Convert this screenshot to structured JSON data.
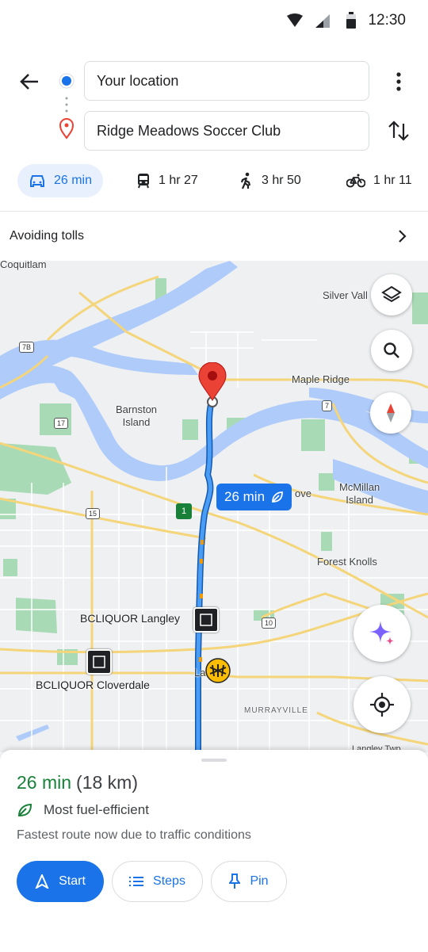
{
  "status_bar": {
    "time": "12:30"
  },
  "directions": {
    "origin": "Your location",
    "destination": "Ridge Meadows Soccer Club"
  },
  "modes": [
    {
      "icon": "car-icon",
      "label": "26 min",
      "selected": true
    },
    {
      "icon": "transit-icon",
      "label": "1 hr 27"
    },
    {
      "icon": "walk-icon",
      "label": "3 hr 50"
    },
    {
      "icon": "bike-icon",
      "label": "1 hr 11"
    }
  ],
  "route_option": "Avoiding tolls",
  "map": {
    "places": {
      "coquitlam": "Coquitlam",
      "silver_valley": "Silver Vall",
      "maple_ridge": "Maple Ridge",
      "barnston_island": "Barnston\nIsland",
      "mcmillan_island": "McMillan\nIsland",
      "forest_knolls": "Forest Knolls",
      "murrayville": "MURRAYVILLE",
      "langley_twp": "Langley Twp",
      "langley_partial": "La",
      "ove_partial": "ove"
    },
    "pois": {
      "bcl_langley": "BCLIQUOR Langley",
      "bcl_cloverdale": "BCLIQUOR Cloverdale"
    },
    "shields": {
      "s7b": "7B",
      "s17": "17",
      "s7": "7",
      "s15": "15",
      "s10": "10",
      "s1": "1"
    },
    "route_eta": "26 min",
    "colors": {
      "route": "#1a73e8",
      "water": "#aecbfa",
      "park": "#a8dab5",
      "road": "#f5d57a",
      "pin": "#ea4335"
    }
  },
  "sheet": {
    "duration": "26 min",
    "distance": "(18 km)",
    "fuel_label": "Most fuel-efficient",
    "note": "Fastest route now due to traffic conditions",
    "start": "Start",
    "steps": "Steps",
    "pin": "Pin"
  }
}
